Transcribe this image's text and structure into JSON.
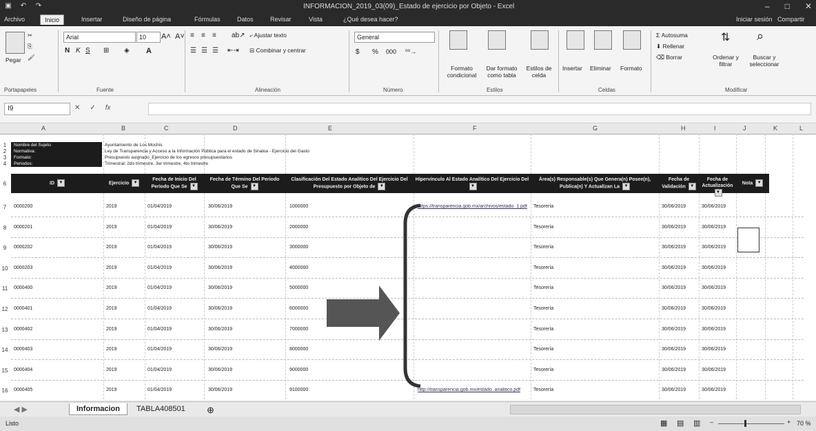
{
  "titlebar": {
    "title": "INFORMACION_2019_03(09)_Estado de ejercicio por Objeto - Excel",
    "min": "–",
    "max": "□",
    "close": "✕"
  },
  "tabs": [
    "Archivo",
    "Inicio",
    "Insertar",
    "Diseño de página",
    "Fórmulas",
    "Datos",
    "Revisar",
    "Vista",
    "¿Qué desea hacer?"
  ],
  "account": {
    "user": "Iniciar sesión",
    "share": "Compartir"
  },
  "ribbon": {
    "paste": "Pegar",
    "font_name": "Arial",
    "font_size": "10",
    "bold": "N",
    "italic": "K",
    "underline": "S",
    "wrap": "Ajustar texto",
    "merge": "Combinar y centrar",
    "number_format": "General",
    "currency": "$",
    "percent": "%",
    "thousands": "000",
    "cond_format": "Formato condicional",
    "table_format": "Dar formato como tabla",
    "cell_styles": "Estilos de celda",
    "insert": "Insertar",
    "delete": "Eliminar",
    "format": "Formato",
    "autosum": "Autosuma",
    "fill": "Rellenar",
    "clear": "Borrar",
    "sort": "Ordenar y filtrar",
    "find": "Buscar y seleccionar",
    "groups": {
      "clipboard": "Portapapeles",
      "font": "Fuente",
      "alignment": "Alineación",
      "number": "Número",
      "styles": "Estilos",
      "cells": "Celdas",
      "editing": "Modificar"
    }
  },
  "formula": {
    "namebox": "I9",
    "cancel": "✕",
    "enter": "✓",
    "fx": "fx"
  },
  "columns": [
    "A",
    "B",
    "C",
    "D",
    "E",
    "F",
    "G",
    "H",
    "I",
    "J",
    "K",
    "L"
  ],
  "meta": {
    "labels": [
      "Nombre del Sujeto",
      "Normativa:",
      "Formato:",
      "Periodos:"
    ],
    "values": [
      "Ayuntamiento de Los Mochis",
      "Ley de Transparencia y Acceso a la Información Pública para el estado de Sinaloa - Ejercicio del Gasto",
      "Presupuesto asignado_Ejercicio de los egresos presupuestarios",
      "Trimestral: 2do trimestre, 3er trimestre, 4to trimestre"
    ]
  },
  "headers": [
    "ID",
    "Ejercicio",
    "Fecha de Inicio Del Periodo Que Se",
    "Fecha de Término Del Periodo Que Se",
    "Clasificación Del Estado Analítico Del Ejercicio Del Presupuesto por Objeto de",
    "Hipervínculo Al Estado Analítico Del Ejercicio Del",
    "Área(s) Responsable(s) Que Genera(n) Posee(n), Publica(n) Y Actualizan La",
    "Fecha de Validación",
    "Fecha de Actualización",
    "Nota"
  ],
  "rows": [
    {
      "n": "7",
      "id": "0000200",
      "year": "2019",
      "start": "01/04/2019",
      "end": "30/06/2019",
      "code": "1000000",
      "link": "https://transparencia.gob.mx/archivos/estado_1.pdf",
      "area": "Tesorería",
      "val": "30/06/2019",
      "upd": "30/06/2019"
    },
    {
      "n": "8",
      "id": "0000201",
      "year": "2019",
      "start": "01/04/2019",
      "end": "30/06/2019",
      "code": "2000000",
      "link": "",
      "area": "Tesorería",
      "val": "30/06/2019",
      "upd": "30/06/2019"
    },
    {
      "n": "9",
      "id": "0000202",
      "year": "2019",
      "start": "01/04/2019",
      "end": "30/06/2019",
      "code": "3000000",
      "link": "",
      "area": "Tesorería",
      "val": "30/06/2019",
      "upd": "30/06/2019"
    },
    {
      "n": "10",
      "id": "0000203",
      "year": "2019",
      "start": "01/04/2019",
      "end": "30/06/2019",
      "code": "4000000",
      "link": "",
      "area": "Tesorería",
      "val": "30/06/2019",
      "upd": "30/06/2019"
    },
    {
      "n": "11",
      "id": "0000400",
      "year": "2019",
      "start": "01/04/2019",
      "end": "30/06/2019",
      "code": "5000000",
      "link": "",
      "area": "Tesorería",
      "val": "30/06/2019",
      "upd": "30/06/2019"
    },
    {
      "n": "12",
      "id": "0000401",
      "year": "2019",
      "start": "01/04/2019",
      "end": "30/06/2019",
      "code": "6000000",
      "link": "",
      "area": "Tesorería",
      "val": "30/06/2019",
      "upd": "30/06/2019"
    },
    {
      "n": "13",
      "id": "0000402",
      "year": "2019",
      "start": "01/04/2019",
      "end": "30/06/2019",
      "code": "7000000",
      "link": "",
      "area": "Tesorería",
      "val": "30/06/2019",
      "upd": "30/06/2019"
    },
    {
      "n": "14",
      "id": "0000403",
      "year": "2019",
      "start": "01/04/2019",
      "end": "30/06/2019",
      "code": "8000000",
      "link": "",
      "area": "Tesorería",
      "val": "30/06/2019",
      "upd": "30/06/2019"
    },
    {
      "n": "15",
      "id": "0000404",
      "year": "2019",
      "start": "01/04/2019",
      "end": "30/06/2019",
      "code": "9000000",
      "link": "",
      "area": "Tesorería",
      "val": "30/06/2019",
      "upd": "30/06/2019"
    },
    {
      "n": "16",
      "id": "0000405",
      "year": "2019",
      "start": "01/04/2019",
      "end": "30/06/2019",
      "code": "9100000",
      "link": "http://transparencia.gob.mx/estado_analitico.pdf",
      "area": "Tesorería",
      "val": "30/06/2019",
      "upd": "30/06/2019"
    }
  ],
  "sheet_tabs": [
    "Informacion",
    "TABLA408501"
  ],
  "add_sheet": "⊕",
  "status": {
    "ready": "Listo",
    "zoom": "70 %"
  },
  "colors": {
    "header_band": "#1c1c1c",
    "arrow": "#555555",
    "titlebar": "#2a2a2a"
  }
}
